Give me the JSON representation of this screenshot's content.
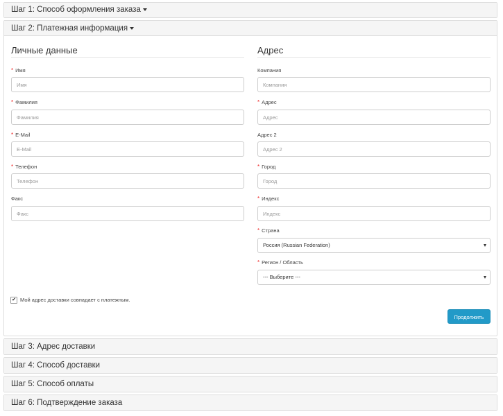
{
  "steps": [
    {
      "label": "Шаг 1: Способ оформления заказа"
    },
    {
      "label": "Шаг 2: Платежная информация"
    },
    {
      "label": "Шаг 3: Адрес доставки"
    },
    {
      "label": "Шаг 4: Способ доставки"
    },
    {
      "label": "Шаг 5: Способ оплаты"
    },
    {
      "label": "Шаг 6: Подтверждение заказа"
    }
  ],
  "personal": {
    "title": "Личные данные",
    "firstname": {
      "label": "Имя",
      "placeholder": "Имя",
      "value": ""
    },
    "lastname": {
      "label": "Фамилия",
      "placeholder": "Фамилия",
      "value": ""
    },
    "email": {
      "label": "E-Mail",
      "placeholder": "E-Mail",
      "value": ""
    },
    "telephone": {
      "label": "Телефон",
      "placeholder": "Телефон",
      "value": ""
    },
    "fax": {
      "label": "Факс",
      "placeholder": "Факс",
      "value": ""
    }
  },
  "address": {
    "title": "Адрес",
    "company": {
      "label": "Компания",
      "placeholder": "Компания",
      "value": ""
    },
    "address1": {
      "label": "Адрес",
      "placeholder": "Адрес",
      "value": ""
    },
    "address2": {
      "label": "Адрес 2",
      "placeholder": "Адрес 2",
      "value": ""
    },
    "city": {
      "label": "Город",
      "placeholder": "Город",
      "value": ""
    },
    "postcode": {
      "label": "Индекс",
      "placeholder": "Индекс",
      "value": ""
    },
    "country": {
      "label": "Страна",
      "selected": "Россия (Russian Federation)"
    },
    "zone": {
      "label": "Регион / Область",
      "selected": " --- Выберите --- "
    }
  },
  "same_address": {
    "label": "Мой адрес доставки совпадает с платежным.",
    "checked_mark": "✔"
  },
  "continue_button": "Продолжить",
  "required_mark": "*",
  "colors": {
    "accent": "#229ac8",
    "required": "#ee2222",
    "panel_heading": "#f5f5f5"
  }
}
